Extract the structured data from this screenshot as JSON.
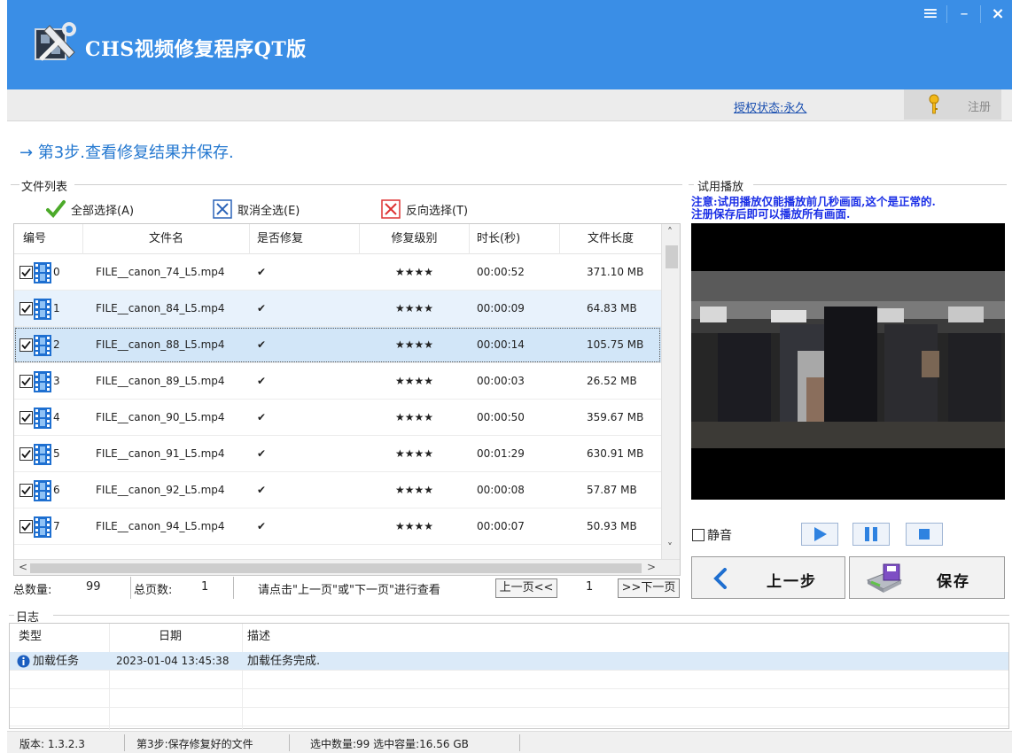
{
  "app": {
    "title": "CHS视频修复程序QT版"
  },
  "license": {
    "status": "授权状态:永久",
    "register_label": "注册"
  },
  "step": {
    "text": "→ 第3步.查看修复结果并保存."
  },
  "file_list": {
    "group_title": "文件列表",
    "select_all": "全部选择(A)",
    "deselect_all": "取消全选(E)",
    "invert": "反向选择(T)",
    "columns": [
      "编号",
      "文件名",
      "是否修复",
      "修复级别",
      "时长(秒)",
      "文件长度"
    ],
    "rows": [
      {
        "id": "0",
        "name": "FILE__canon_74_L5.mp4",
        "repaired": "✔",
        "level": "★★★★",
        "duration": "00:00:52",
        "size": "371.10 MB"
      },
      {
        "id": "1",
        "name": "FILE__canon_84_L5.mp4",
        "repaired": "✔",
        "level": "★★★★",
        "duration": "00:00:09",
        "size": "64.83 MB"
      },
      {
        "id": "2",
        "name": "FILE__canon_88_L5.mp4",
        "repaired": "✔",
        "level": "★★★★",
        "duration": "00:00:14",
        "size": "105.75 MB"
      },
      {
        "id": "3",
        "name": "FILE__canon_89_L5.mp4",
        "repaired": "✔",
        "level": "★★★★",
        "duration": "00:00:03",
        "size": "26.52 MB"
      },
      {
        "id": "4",
        "name": "FILE__canon_90_L5.mp4",
        "repaired": "✔",
        "level": "★★★★",
        "duration": "00:00:50",
        "size": "359.67 MB"
      },
      {
        "id": "5",
        "name": "FILE__canon_91_L5.mp4",
        "repaired": "✔",
        "level": "★★★★",
        "duration": "00:01:29",
        "size": "630.91 MB"
      },
      {
        "id": "6",
        "name": "FILE__canon_92_L5.mp4",
        "repaired": "✔",
        "level": "★★★★",
        "duration": "00:00:08",
        "size": "57.87 MB"
      },
      {
        "id": "7",
        "name": "FILE__canon_94_L5.mp4",
        "repaired": "✔",
        "level": "★★★★",
        "duration": "00:00:07",
        "size": "50.93 MB"
      }
    ]
  },
  "pager": {
    "total_label": "总数量:",
    "total": "99",
    "pages_label": "总页数:",
    "pages": "1",
    "hint": "请点击\"上一页\"或\"下一页\"进行查看",
    "prev": "上一页<<",
    "current": "1",
    "next": ">>下一页"
  },
  "preview": {
    "group_title": "试用播放",
    "note_line1": "注意:试用播放仅能播放前几秒画面,这个是正常的.",
    "note_line2": "注册保存后即可以播放所有画面.",
    "mute_label": "静音"
  },
  "nav": {
    "back": "上一步",
    "save": "保存"
  },
  "log": {
    "group_title": "日志",
    "columns": [
      "类型",
      "日期",
      "描述"
    ],
    "rows": [
      {
        "type": "加载任务",
        "date": "2023-01-04 13:45:38",
        "desc": "加载任务完成."
      }
    ]
  },
  "statusbar": {
    "version": "版本:  1.3.2.3",
    "step": "第3步:保存修复好的文件",
    "selection": "选中数量:99 选中容量:16.56 GB"
  },
  "colors": {
    "title_blue": "#3a8ee6",
    "note_blue": "#1a2ee6",
    "link_blue": "#1a4fb0"
  }
}
